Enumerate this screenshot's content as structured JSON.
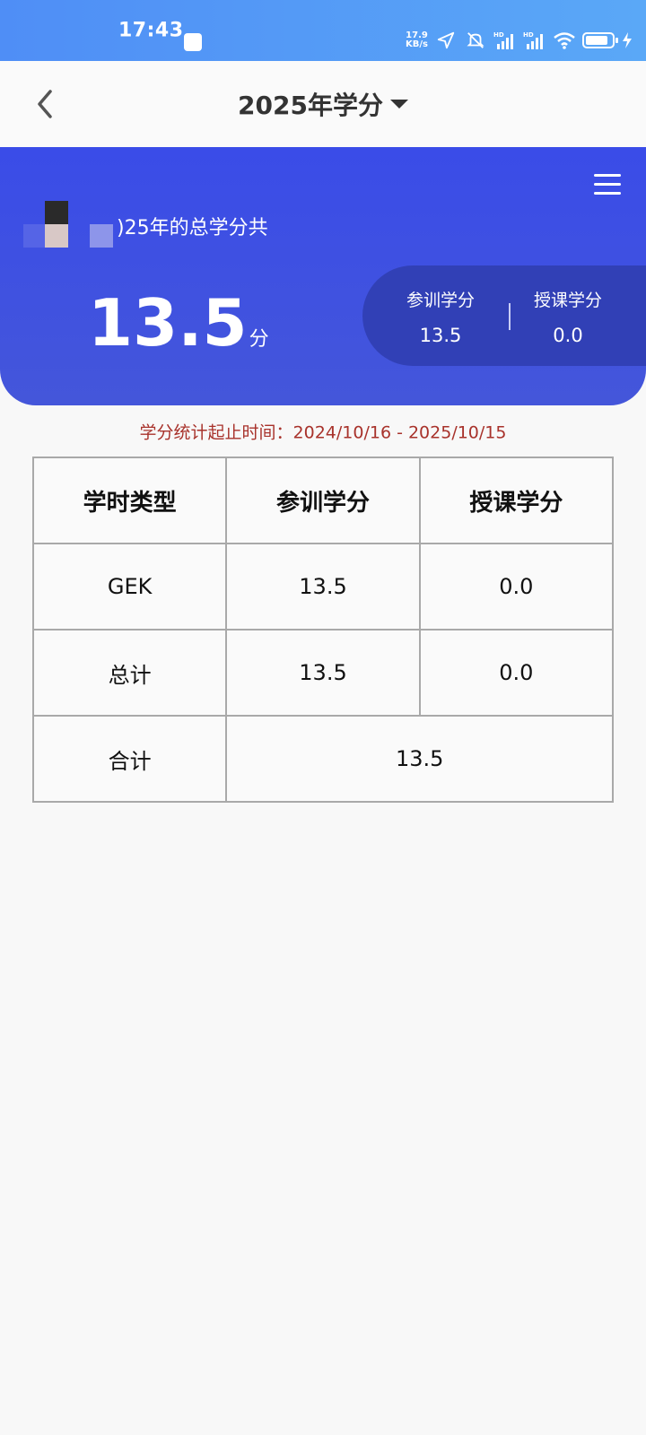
{
  "status_bar": {
    "time": "17:43",
    "net_speed_value": "17.9",
    "net_speed_unit": "KB/s",
    "icons": [
      "location-arrow-icon",
      "mute-icon",
      "signal-hd-icon",
      "signal-hd-icon",
      "wifi-icon",
      "battery-icon",
      "charging-icon"
    ]
  },
  "nav": {
    "title": "2025年学分",
    "back_icon": "chevron-left-icon",
    "dropdown_icon": "caret-down-icon"
  },
  "hero": {
    "label": ")25年的总学分共",
    "total_value": "13.5",
    "total_unit": "分",
    "stats": [
      {
        "label": "参训学分",
        "value": "13.5"
      },
      {
        "label": "授课学分",
        "value": "0.0"
      }
    ],
    "colors": {
      "hero_bg": "#3a4ce8",
      "stat_panel_bg": "#3140b6"
    }
  },
  "date_range": "学分统计起止时间：2024/10/16 - 2025/10/15",
  "table": {
    "headers": [
      "学时类型",
      "参训学分",
      "授课学分"
    ],
    "rows": [
      [
        "GEK",
        "13.5",
        "0.0"
      ],
      [
        "总计",
        "13.5",
        "0.0"
      ]
    ],
    "sum_row": {
      "label": "合计",
      "value": "13.5"
    }
  },
  "colors": {
    "accent": "#3a4ce8",
    "date_text": "#a8322b",
    "status_bar": "#4f8ef6"
  }
}
